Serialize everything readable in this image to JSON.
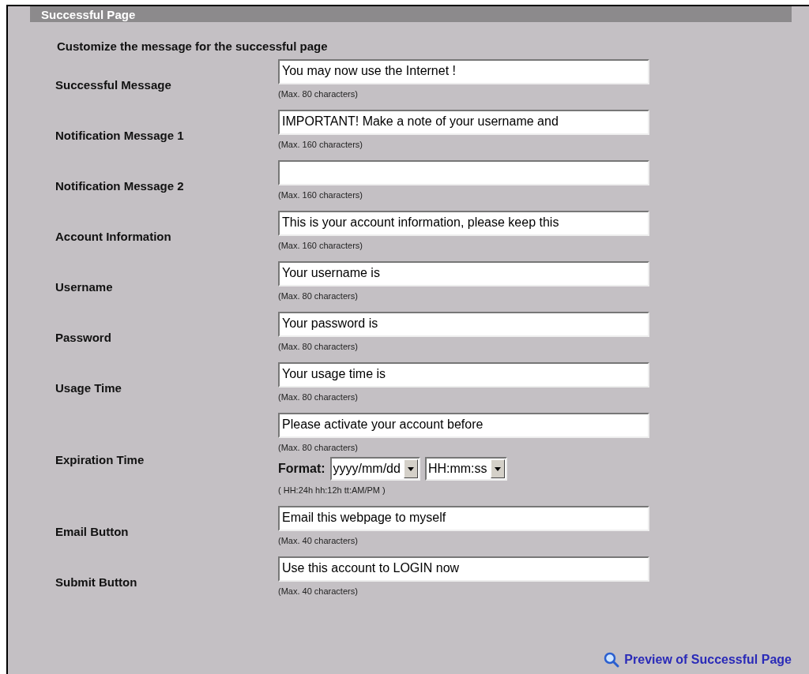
{
  "section_title": "Successful Page",
  "heading": "Customize the message for the successful page",
  "rows": [
    {
      "kind": "text",
      "label": "Successful Message",
      "value": "You may now use the Internet !",
      "hint": "(Max. 80 characters)"
    },
    {
      "kind": "text",
      "label": "Notification Message 1",
      "value": "IMPORTANT! Make a note of your username and",
      "hint": "(Max. 160 characters)"
    },
    {
      "kind": "text",
      "label": "Notification Message 2",
      "hint": "(Max. 160 characters)"
    },
    {
      "kind": "text",
      "label": "Account Information",
      "value": "This is your account information, please keep this",
      "hint": "(Max. 160 characters)"
    },
    {
      "kind": "text",
      "label": "Username",
      "value": "Your username is",
      "hint": "(Max. 80 characters)"
    },
    {
      "kind": "text",
      "label": "Password",
      "value": "Your password is",
      "hint": "(Max. 80 characters)"
    },
    {
      "kind": "text",
      "label": "Usage Time",
      "value": "Your usage time is",
      "hint": "(Max. 80 characters)"
    },
    {
      "kind": "expiration",
      "label": "Expiration Time",
      "value": "Please activate your account before",
      "hint": "(Max. 80 characters)",
      "format_label": "Format:",
      "selects": [
        "yyyy/mm/dd",
        "HH:mm:ss"
      ],
      "format_hint": "( HH:24h hh:12h tt:AM/PM )"
    },
    {
      "kind": "text",
      "label": "Email Button",
      "value": "Email this webpage to myself",
      "hint": "(Max. 40 characters)"
    },
    {
      "kind": "text",
      "label": "Submit Button",
      "value": "Use this account to LOGIN now",
      "hint": "(Max. 40 characters)"
    }
  ],
  "preview_link": "Preview of Successful Page"
}
